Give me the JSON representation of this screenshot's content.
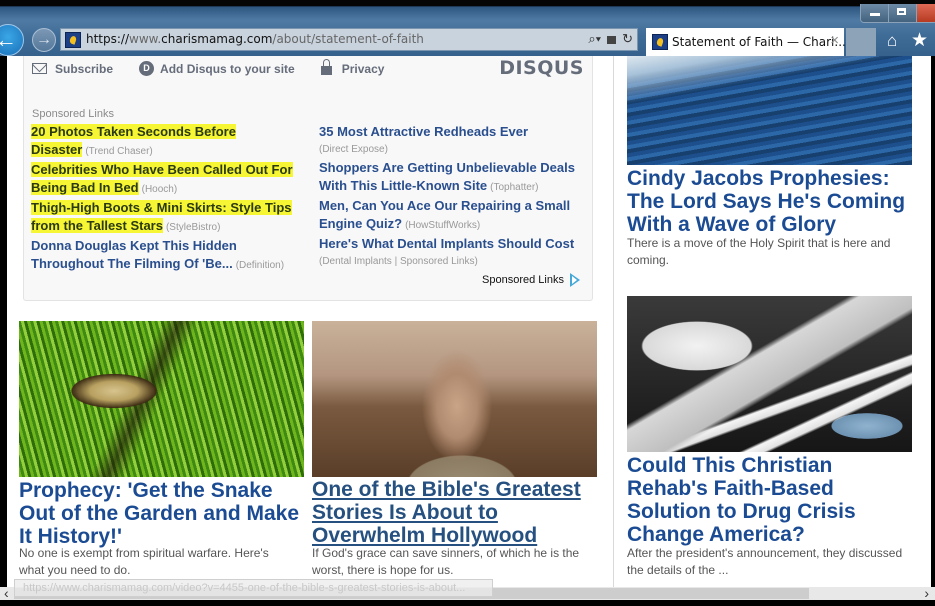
{
  "browser": {
    "url_scheme": "https://",
    "url_prefix": "www.",
    "url_domain": "charismamag.com",
    "url_path": "/about/statement-of-faith",
    "tab_title": "Statement of Faith — Chari...",
    "tab_close": "×",
    "back_glyph": "←",
    "forward_glyph": "→",
    "home_glyph": "⌂",
    "favorites_glyph": "★",
    "addr_icons": [
      "⌕▾",
      "🔒",
      "↻"
    ],
    "status_url": "https://www.charismamag.com/video?v=4455-one-of-the-bible-s-greatest-stories-is-about..."
  },
  "disqus": {
    "subscribe": "Subscribe",
    "add_disqus": "Add Disqus to your site",
    "privacy": "Privacy",
    "logo": "DISQUS",
    "disqus_d": "D"
  },
  "sponsored": {
    "label": "Sponsored Links",
    "footer": "Sponsored Links",
    "left": [
      {
        "title": "20 Photos Taken Seconds Before Disaster",
        "source": "(Trend Chaser)",
        "highlight": true
      },
      {
        "title": "Celebrities Who Have Been Called Out For Being Bad In Bed",
        "source": "(Hooch)",
        "highlight": true
      },
      {
        "title": "Thigh-High Boots & Mini Skirts: Style Tips from the Tallest Stars",
        "source": "(StyleBistro)",
        "highlight": true
      },
      {
        "title": "Donna Douglas Kept This Hidden Throughout The Filming Of 'Be...",
        "source": "(Definition)",
        "highlight": false
      }
    ],
    "right": [
      {
        "title": "35 Most Attractive Redheads Ever",
        "source": "(Direct Expose)"
      },
      {
        "title": "Shoppers Are Getting Unbelievable Deals With This Little-Known Site",
        "source": "(Tophatter)"
      },
      {
        "title": "Men, Can You Ace Our Repairing a Small Engine Quiz?",
        "source": "(HowStuffWorks)"
      },
      {
        "title": "Here's What Dental Implants Should Cost",
        "source": "(Dental Implants | Sponsored Links)"
      }
    ]
  },
  "articles": {
    "snake": {
      "title": "Prophecy: 'Get the Snake Out of the Garden and Make It History!'",
      "summary": "No one is exempt from spiritual warfare. Here's what you need to do."
    },
    "bible": {
      "title": "One of the Bible's Greatest Stories Is About to Overwhelm Hollywood",
      "summary": "If God's grace can save sinners, of which he is the worst, there is hope for us."
    },
    "wave": {
      "title": "Cindy Jacobs Prophesies: The Lord Says He's Coming With a Wave of Glory",
      "summary": "There is a move of the Holy Spirit that is here and coming."
    },
    "rehab": {
      "title": "Could This Christian Rehab's Faith-Based Solution to Drug Crisis Change America?",
      "summary": "After the president's announcement, they discussed the details of the ..."
    }
  },
  "scrollbar": {
    "left_glyph": "‹",
    "right_glyph": "›"
  }
}
